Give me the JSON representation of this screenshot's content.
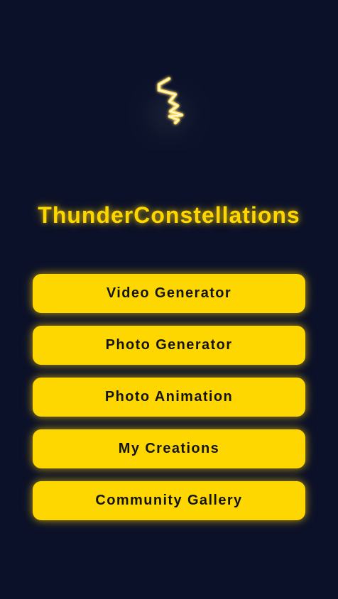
{
  "app": {
    "title": "ThunderConstellations",
    "logo_icon": "lightning-bolt-icon",
    "accent_color": "#ffd700",
    "background_color": "#0b1129"
  },
  "menu": {
    "items": [
      {
        "label": "Video Generator"
      },
      {
        "label": "Photo Generator"
      },
      {
        "label": "Photo Animation"
      },
      {
        "label": "My Creations"
      },
      {
        "label": "Community Gallery"
      }
    ]
  }
}
